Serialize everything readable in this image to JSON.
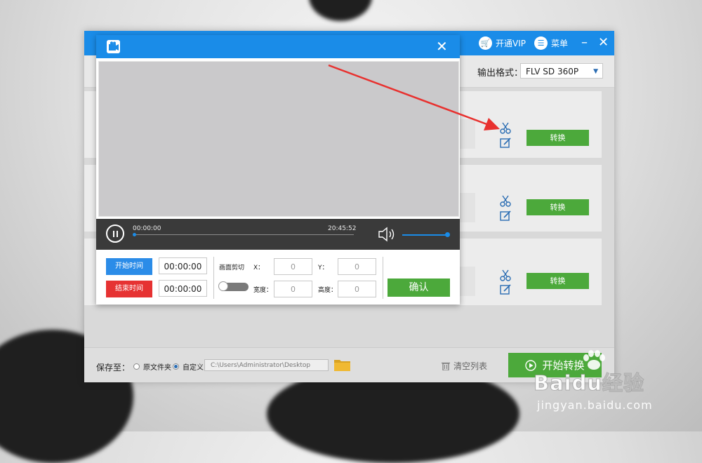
{
  "app": {
    "vip_label": "开通VIP",
    "menu_label": "菜单",
    "output_format_label": "输出格式：",
    "output_format_value": "FLV  SD 360P",
    "rows": [
      {
        "convert_label": "转换"
      },
      {
        "convert_label": "转换"
      },
      {
        "convert_label": "转换"
      }
    ],
    "footer": {
      "save_to_label": "保存至：",
      "radio_source": "原文件夹",
      "radio_custom": "自定义",
      "path_value": "C:\\Users\\Administrator\\Desktop",
      "clear_list_label": "清空列表",
      "start_convert_label": "开始转换"
    }
  },
  "dialog": {
    "player": {
      "current_time": "00:00:00",
      "total_time": "20:45:52"
    },
    "controls": {
      "start_time_label": "开始时间",
      "start_time_value": "00:00:00",
      "end_time_label": "结束时间",
      "end_time_value": "00:00:00",
      "crop_label": "画面剪切",
      "x_label": "X：",
      "x_value": "0",
      "y_label": "Y：",
      "y_value": "0",
      "width_label": "宽度：",
      "width_value": "0",
      "height_label": "高度：",
      "height_value": "0",
      "confirm_label": "确认"
    }
  },
  "watermark": {
    "brand": "Baidu经验",
    "url": "jingyan.baidu.com"
  },
  "colors": {
    "title_blue": "#1a8ce8",
    "green": "#4ca93b",
    "red": "#e63232",
    "arrow_red": "#e8312f"
  }
}
